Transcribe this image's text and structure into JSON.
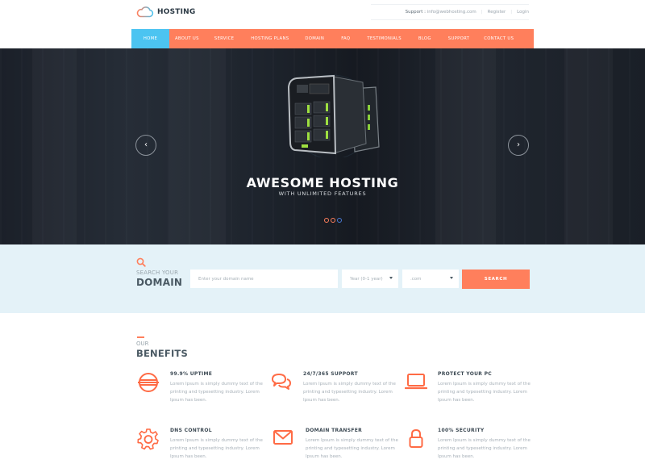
{
  "brand": {
    "name": "HOSTING",
    "accent": "#ff7f5c",
    "active_nav": "#4cc4f1"
  },
  "top_links": {
    "support_label": "Support :",
    "support_email": "info@webhosting.com",
    "register": "Register",
    "login": "Login"
  },
  "nav": {
    "items": [
      {
        "label": "HOME",
        "active": true
      },
      {
        "label": "ABOUT US"
      },
      {
        "label": "SERVICE"
      },
      {
        "label": "HOSTING PLANS"
      },
      {
        "label": "DOMAIN"
      },
      {
        "label": "FAQ"
      },
      {
        "label": "TESTIMONIALS"
      },
      {
        "label": "BLOG"
      },
      {
        "label": "SUPPORT"
      },
      {
        "label": "CONTACT US"
      }
    ]
  },
  "hero": {
    "title": "AWESOME HOSTING",
    "subtitle": "WITH UNLIMITED FEATURES",
    "prev_icon": "‹",
    "next_icon": "›",
    "slides": 3,
    "active_slide": 3
  },
  "search": {
    "label_small": "SEARCH YOUR",
    "label_big": "DOMAIN",
    "input_placeholder": "Enter your domain name",
    "input_value": "",
    "year_select": "Year (0-1 year)",
    "tld_select": ".com",
    "button": "SEARCH"
  },
  "benefits": {
    "label_small": "OUR",
    "label_big": "BENEFITS",
    "items": [
      {
        "icon": "uptime-icon",
        "title": "99.9% UPTIME",
        "text": "Lorem Ipsum is simply dummy text of the printing and typesetting industry. Lorem Ipsum has been."
      },
      {
        "icon": "chat-icon",
        "title": "24/7/365 SUPPORT",
        "text": "Lorem Ipsum is simply dummy text of the printing and typesetting industry. Lorem Ipsum has been."
      },
      {
        "icon": "laptop-icon",
        "title": "PROTECT YOUR PC",
        "text": "Lorem Ipsum is simply dummy text of the printing and typesetting industry. Lorem Ipsum has been."
      },
      {
        "icon": "gear-icon",
        "title": "DNS CONTROL",
        "text": "Lorem Ipsum is simply dummy text of the printing and typesetting industry. Lorem Ipsum has been."
      },
      {
        "icon": "envelope-icon",
        "title": "DOMAIN TRANSFER",
        "text": "Lorem Ipsum is simply dummy text of the printing and typesetting industry. Lorem Ipsum has been."
      },
      {
        "icon": "lock-icon",
        "title": "100% SECURITY",
        "text": "Lorem Ipsum is simply dummy text of the printing and typesetting industry. Lorem Ipsum has been."
      }
    ]
  }
}
